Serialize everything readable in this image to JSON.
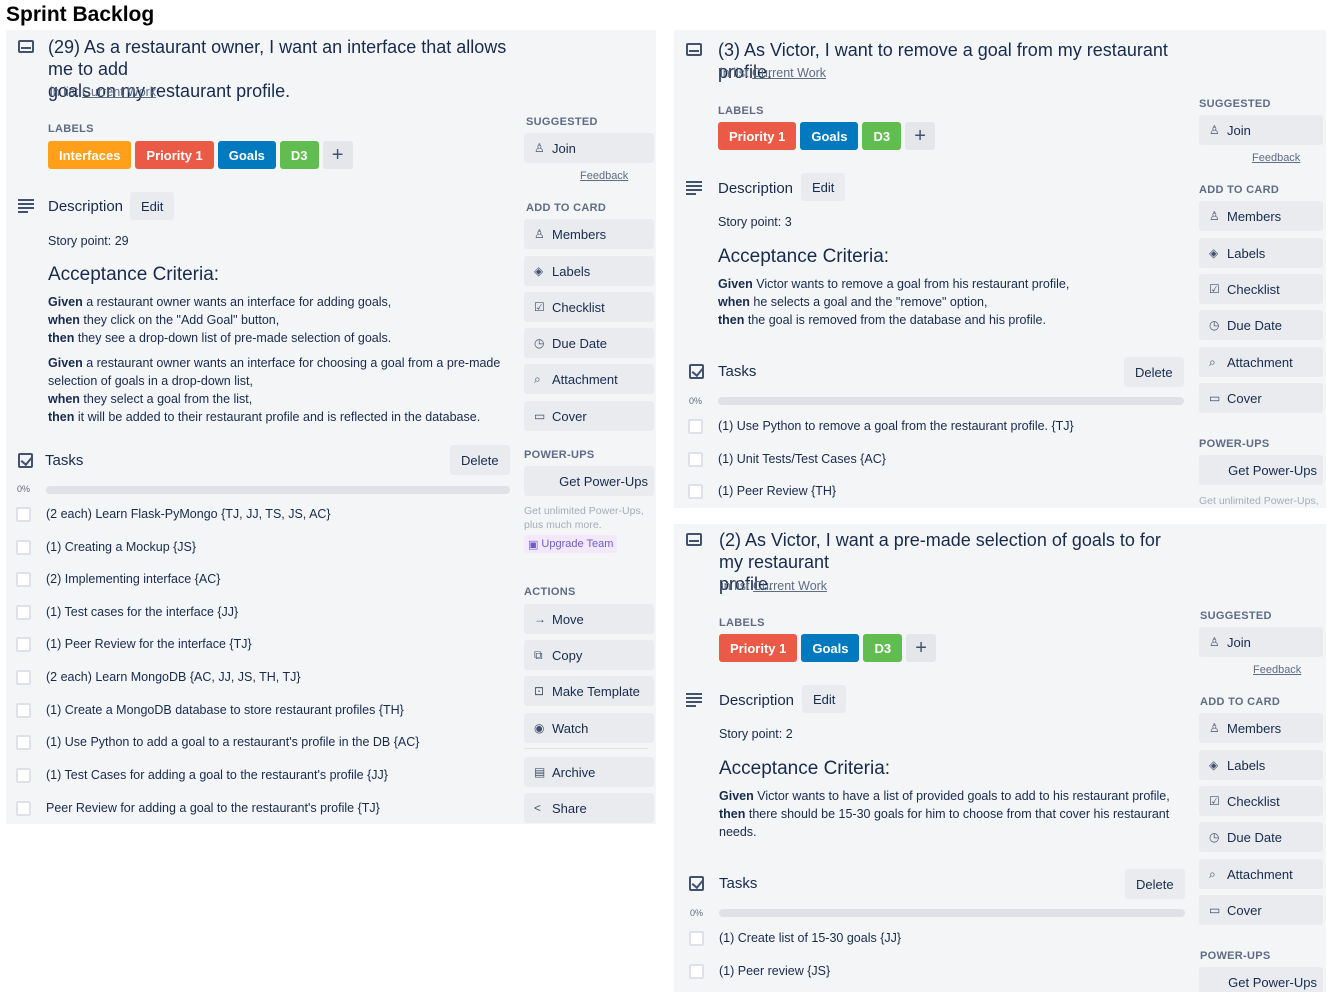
{
  "page": {
    "title": "Sprint Backlog"
  },
  "colors": {
    "orange": "#ff9f1a",
    "red": "#eb5a46",
    "blue": "#0079bf",
    "green": "#61bd4f",
    "card_bg": "#f4f5f7",
    "progress_green": "#5aac44"
  },
  "ui": {
    "in_list_prefix": "in list",
    "labels_heading": "LABELS",
    "add_label": "+",
    "description": "Description",
    "edit": "Edit",
    "acceptance_criteria": "Acceptance Criteria:",
    "tasks": "Tasks",
    "delete": "Delete",
    "progress": "0%",
    "given": "Given",
    "when": "when",
    "then": "then",
    "suggested": "SUGGESTED",
    "join": "Join",
    "feedback": "Feedback",
    "add_to_card": "ADD TO CARD",
    "members": "Members",
    "labels": "Labels",
    "checklist": "Checklist",
    "due_date": "Due Date",
    "attachment": "Attachment",
    "cover": "Cover",
    "power_ups": "POWER-UPS",
    "get_power_ups": "Get Power-Ups",
    "unlimited_powerups": "Get unlimited Power-Ups, plus much more.",
    "unlimited_powerups_short": "Get unlimited Power-Ups,",
    "upgrade_team": "Upgrade Team",
    "actions": "ACTIONS",
    "move": "Move",
    "copy": "Copy",
    "make_template": "Make Template",
    "watch": "Watch",
    "archive": "Archive",
    "share": "Share"
  },
  "cards": [
    {
      "title_line1": "(29) As a restaurant owner, I want an interface that allows me to add",
      "title_line2": "goals on my restaurant profile.",
      "list_name": "Current Work",
      "labels": [
        {
          "text": "Interfaces",
          "color": "orange"
        },
        {
          "text": "Priority 1",
          "color": "red"
        },
        {
          "text": "Goals",
          "color": "blue"
        },
        {
          "text": "D3",
          "color": "green"
        }
      ],
      "story_point": "Story point: 29",
      "criteria": [
        {
          "given": " a restaurant owner wants an interface for adding goals,",
          "when": " they click on the \"Add Goal\" button,",
          "then": " they see a drop-down list of pre-made selection of goals."
        },
        {
          "given": " a restaurant owner wants an interface for choosing a goal from a pre-made",
          "given_cont": "selection of goals in a drop-down list,",
          "when": " they select a goal from the list,",
          "then": " it will be added to their restaurant profile and is reflected in the database."
        }
      ],
      "progress_fraction": 0,
      "tasks": [
        "(2 each) Learn Flask-PyMongo {TJ, JJ, TS, JS, AC}",
        "(1) Creating a Mockup {JS}",
        "(2) Implementing interface {AC}",
        "(1) Test cases for the interface {JJ}",
        "(1) Peer Review for the interface {TJ}",
        "(2 each) Learn MongoDB {AC, JJ, JS, TH, TJ}",
        "(1) Create a MongoDB database to store restaurant profiles {TH}",
        "(1) Use Python to add a goal to a restaurant's profile in the DB {AC}",
        "(1) Test Cases for adding a goal to the restaurant's profile {JJ}",
        "Peer Review for adding a goal to the restaurant's profile {TJ}"
      ]
    },
    {
      "title_line1": "(3) As Victor, I want to remove a goal from my restaurant profile.",
      "list_name": "Current Work",
      "labels": [
        {
          "text": "Priority 1",
          "color": "red"
        },
        {
          "text": "Goals",
          "color": "blue"
        },
        {
          "text": "D3",
          "color": "green"
        }
      ],
      "story_point": "Story point: 3",
      "criteria": [
        {
          "given": " Victor wants to remove a goal from his restaurant profile,",
          "when": " he selects a goal and the \"remove\" option,",
          "then": " the goal is removed from the database and his profile."
        }
      ],
      "progress_fraction": 0,
      "tasks": [
        "(1) Use Python to remove a goal from the restaurant profile. {TJ}",
        "(1) Unit Tests/Test Cases {AC}",
        "(1) Peer Review {TH}"
      ]
    },
    {
      "title_line1": "(2) As Victor, I want a pre-made selection of goals to for my restaurant",
      "title_line2": "profile.",
      "list_name": "Current Work",
      "labels": [
        {
          "text": "Priority 1",
          "color": "red"
        },
        {
          "text": "Goals",
          "color": "blue"
        },
        {
          "text": "D3",
          "color": "green"
        }
      ],
      "story_point": "Story point: 2",
      "criteria": [
        {
          "given": " Victor wants to have a list of provided goals to add to his restaurant profile,",
          "then": " there should be 15-30 goals for him to choose from that cover his restaurant",
          "then_cont": "needs."
        }
      ],
      "progress_fraction": 0,
      "tasks": [
        "(1) Create list of 15-30 goals {JJ}",
        "(1) Peer review {JS}"
      ]
    }
  ]
}
